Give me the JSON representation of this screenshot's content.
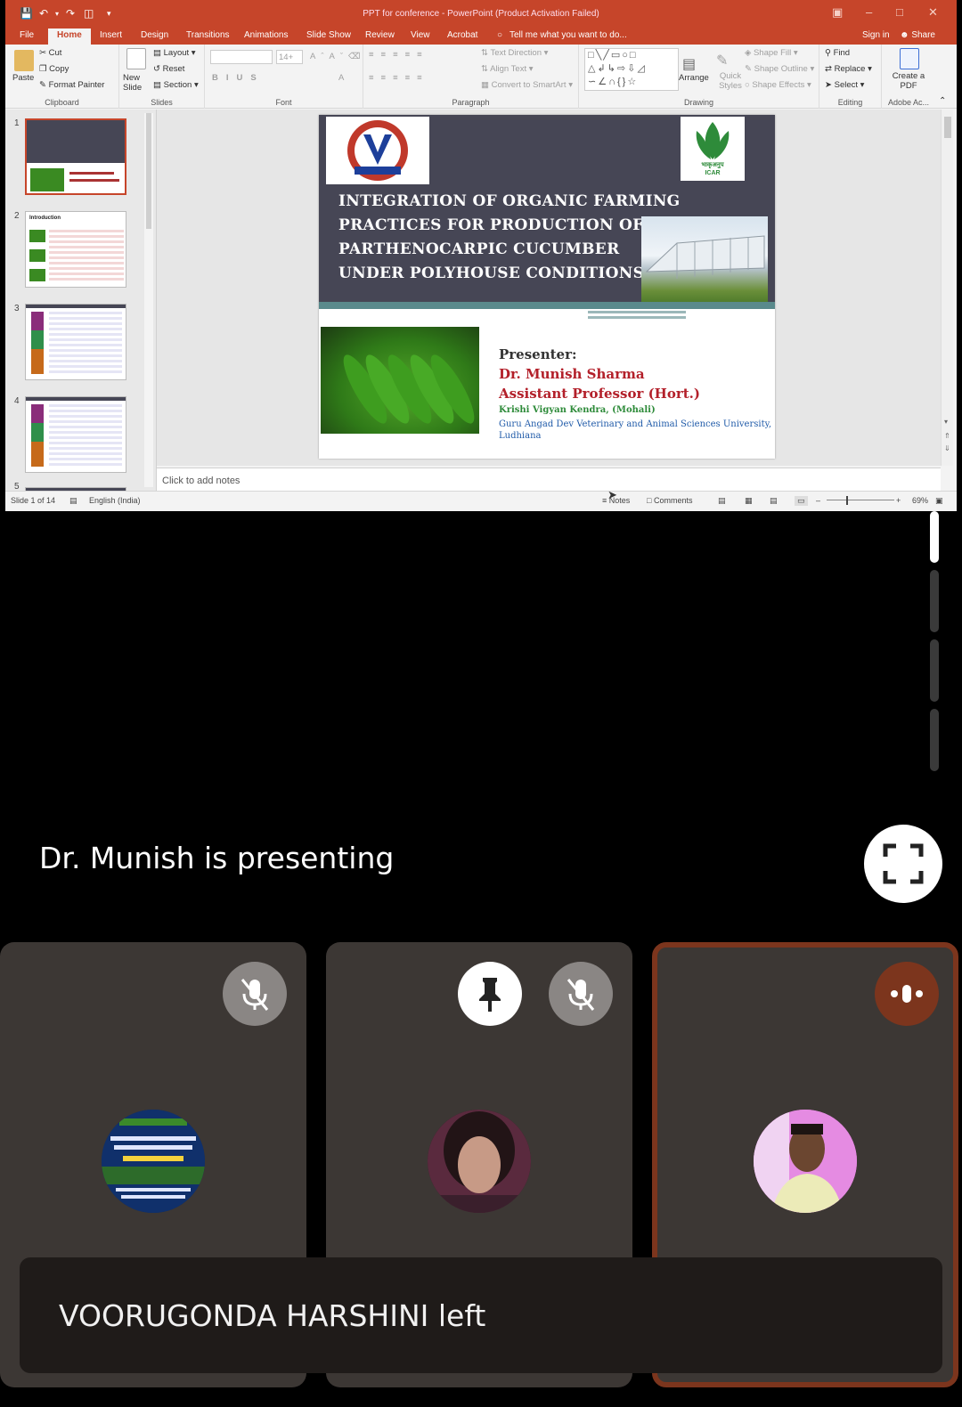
{
  "window": {
    "title": "PPT for conference - PowerPoint (Product Activation Failed)"
  },
  "menu_tabs": [
    "File",
    "Home",
    "Insert",
    "Design",
    "Transitions",
    "Animations",
    "Slide Show",
    "Review",
    "View",
    "Acrobat"
  ],
  "tell_me": "Tell me what you want to do...",
  "sign_in": "Sign in",
  "share": "Share",
  "ribbon": {
    "clipboard": {
      "paste": "Paste",
      "cut": "Cut",
      "copy": "Copy",
      "format_painter": "Format Painter",
      "label": "Clipboard"
    },
    "slides": {
      "new_slide": "New Slide",
      "layout": "Layout",
      "reset": "Reset",
      "section": "Section",
      "label": "Slides"
    },
    "font": {
      "size": "14+",
      "label": "Font"
    },
    "paragraph": {
      "text_direction": "Text Direction",
      "align_text": "Align Text",
      "convert_smartart": "Convert to SmartArt",
      "label": "Paragraph"
    },
    "drawing": {
      "arrange": "Arrange",
      "quick_styles": "Quick Styles",
      "shape_fill": "Shape Fill",
      "shape_outline": "Shape Outline",
      "shape_effects": "Shape Effects",
      "label": "Drawing"
    },
    "editing": {
      "find": "Find",
      "replace": "Replace",
      "select": "Select",
      "label": "Editing"
    },
    "adobe": {
      "create_pdf": "Create a PDF",
      "label": "Adobe Ac..."
    }
  },
  "thumbnails": [
    {
      "num": "1"
    },
    {
      "num": "2",
      "heading": "Introduction"
    },
    {
      "num": "3"
    },
    {
      "num": "4"
    },
    {
      "num": "5"
    }
  ],
  "slide": {
    "title_lines": [
      "INTEGRATION OF ORGANIC FARMING",
      "PRACTICES FOR PRODUCTION OF",
      "PARTHENOCARPIC CUCUMBER",
      "UNDER POLYHOUSE CONDITIONS"
    ],
    "logo_caption": "भाकृअनुप\nICAR",
    "presenter_label": "Presenter:",
    "presenter_name": "Dr. Munish Sharma",
    "presenter_role": "Assistant Professor (Hort.)",
    "presenter_org": "Krishi Vigyan Kendra, (Mohali)",
    "presenter_univ_1": "Guru Angad Dev Veterinary and Animal Sciences University,",
    "presenter_univ_2": "Ludhiana"
  },
  "notes_placeholder": "Click to add notes",
  "status": {
    "slide_count": "Slide 1 of 14",
    "language": "English (India)",
    "notes": "Notes",
    "comments": "Comments",
    "zoom": "69%"
  },
  "meet": {
    "presenting_text": "Dr. Munish is presenting",
    "toast": "VOORUGONDA HARSHINI left"
  },
  "colors": {
    "ppt_accent": "#c6452a",
    "slide_band": "#464655",
    "presenter_red": "#b3202a",
    "presenter_green": "#2e8b3a",
    "tile_bg": "#3c3734",
    "active_speaker": "#7c351d"
  }
}
